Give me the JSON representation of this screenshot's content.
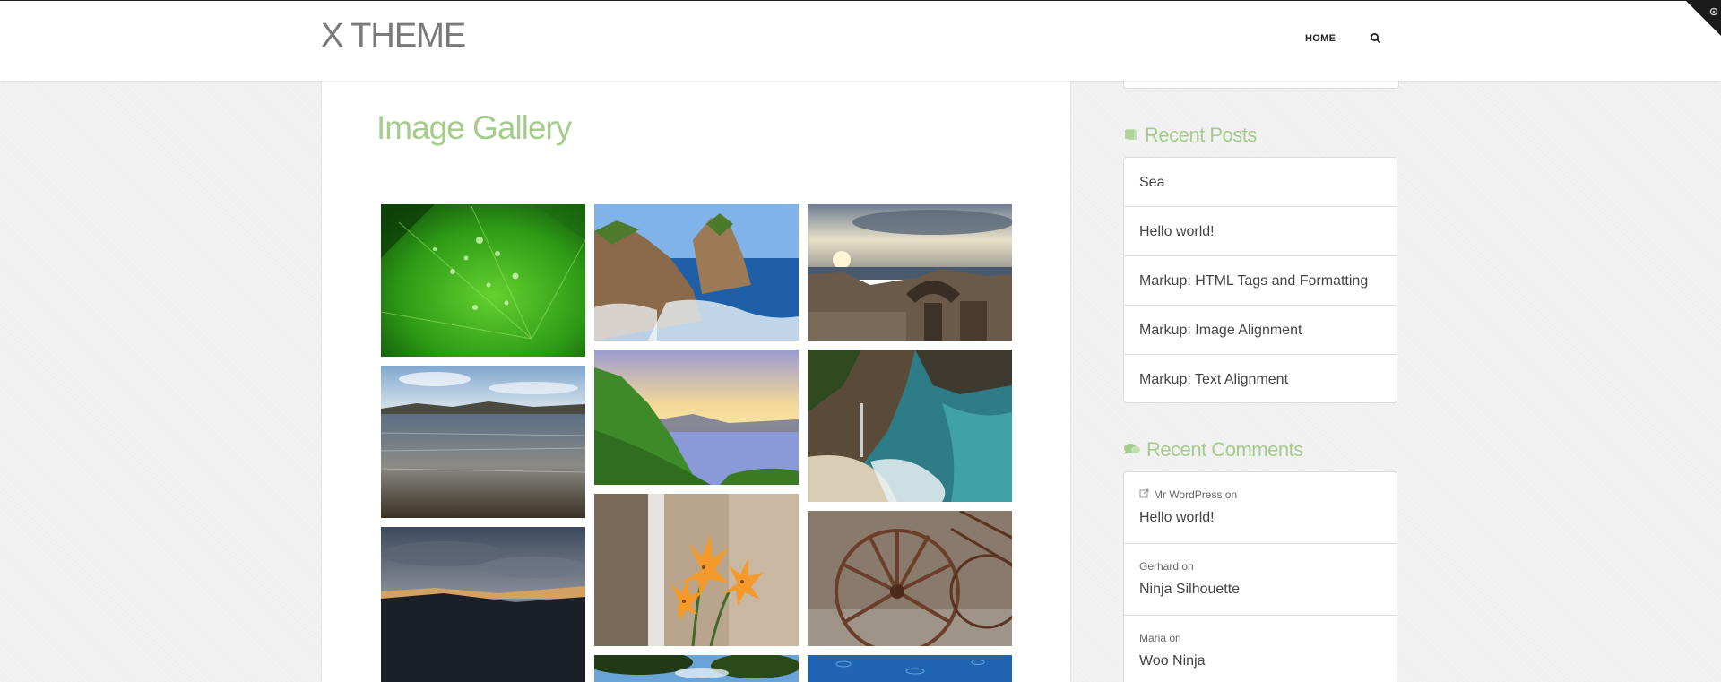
{
  "header": {
    "brand": "X THEME",
    "nav_home": "HOME"
  },
  "main": {
    "title": "Image Gallery",
    "gallery": [
      {
        "subject": "leaf with water droplets"
      },
      {
        "subject": "rocky coast and blue sea"
      },
      {
        "subject": "sunset rock arch on beach"
      },
      {
        "subject": "shallow water over rocks"
      },
      {
        "subject": "green hill at sunset over sea"
      },
      {
        "subject": "waterfall cove beach"
      },
      {
        "subject": "dusk clouds over hills"
      },
      {
        "subject": "orange lily flowers"
      },
      {
        "subject": "old wagon wheel"
      },
      {
        "subject": "trees and sky"
      },
      {
        "subject": "blue water with raindrops"
      }
    ]
  },
  "sidebar": {
    "recent_posts": {
      "title": "Recent Posts",
      "items": [
        "Sea",
        "Hello world!",
        "Markup: HTML Tags and Formatting",
        "Markup: Image Alignment",
        "Markup: Text Alignment"
      ]
    },
    "recent_comments": {
      "title": "Recent Comments",
      "items": [
        {
          "author": "Mr WordPress",
          "on": "on",
          "post": "Hello world!"
        },
        {
          "author": "Gerhard",
          "on": "on",
          "post": "Ninja Silhouette"
        },
        {
          "author": "Maria",
          "on": "on",
          "post": "Woo Ninja"
        }
      ]
    }
  },
  "colors": {
    "accent_green": "#a5cc8b",
    "text_dark": "#444444",
    "brand_gray": "#7a7a7a"
  },
  "icons": {
    "search": "search-icon",
    "posts": "document-icon",
    "comments": "speech-bubbles-icon",
    "external": "external-link-icon",
    "corner": "settings-icon"
  }
}
